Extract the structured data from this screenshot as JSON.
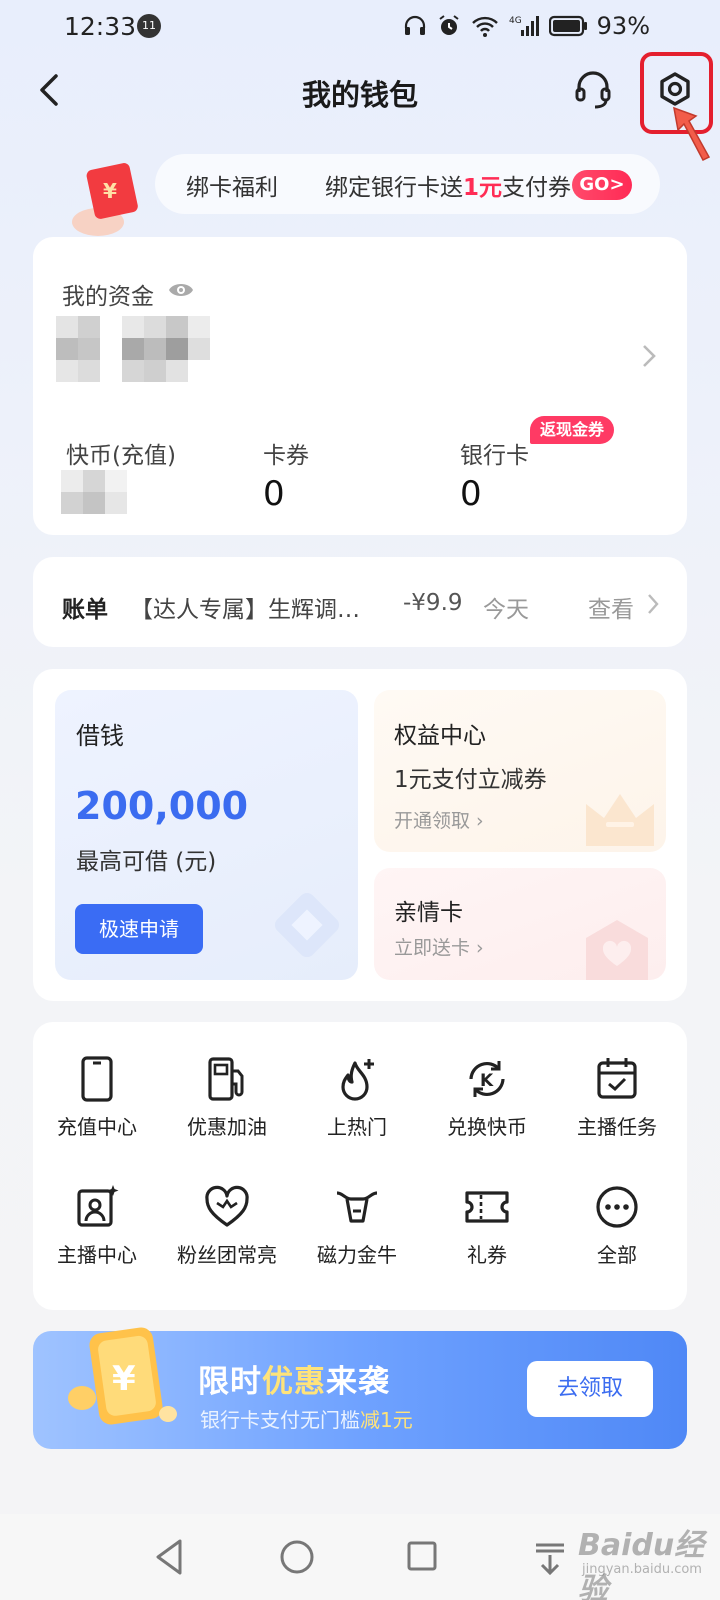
{
  "status_bar": {
    "time": "12:33",
    "clock_badge": "11",
    "battery": "93%"
  },
  "nav": {
    "title": "我的钱包"
  },
  "promo": {
    "label": "绑卡福利",
    "text_prefix": "绑定银行卡送",
    "text_highlight": "1元",
    "text_suffix": "支付券",
    "go": "GO>"
  },
  "assets": {
    "label": "我的资金",
    "kuaibi_label": "快币(充值)",
    "coupon_label": "卡券",
    "coupon_value": "0",
    "bank_label": "银行卡",
    "bank_value": "0",
    "cashback_badge": "返现金券"
  },
  "bill": {
    "label": "账单",
    "description": "【达人专属】生辉调…",
    "amount": "-¥9.9",
    "date": "今天",
    "view": "查看"
  },
  "loan": {
    "title": "借钱",
    "amount": "200,000",
    "caption": "最高可借 (元)",
    "button": "极速申请"
  },
  "benefit": {
    "title": "权益中心",
    "desc": "1元支付立减券",
    "link": "开通领取 ›"
  },
  "family": {
    "title": "亲情卡",
    "link": "立即送卡 ›"
  },
  "services": [
    {
      "label": "充值中心",
      "icon": "phone-icon"
    },
    {
      "label": "优惠加油",
      "icon": "fuel-pump-icon"
    },
    {
      "label": "上热门",
      "icon": "flame-plus-icon"
    },
    {
      "label": "兑换快币",
      "icon": "coin-exchange-icon"
    },
    {
      "label": "主播任务",
      "icon": "calendar-check-icon"
    },
    {
      "label": "主播中心",
      "icon": "streamer-profile-icon"
    },
    {
      "label": "粉丝团常亮",
      "icon": "heart-icon"
    },
    {
      "label": "磁力金牛",
      "icon": "bull-icon"
    },
    {
      "label": "礼券",
      "icon": "ticket-icon"
    },
    {
      "label": "全部",
      "icon": "more-dots-icon"
    }
  ],
  "banner": {
    "title_a": "限时",
    "title_hl": "优惠",
    "title_b": "来袭",
    "sub_a": "银行卡支付无门槛",
    "sub_hl": "减1元",
    "button": "去领取"
  },
  "watermark": {
    "main": "Baidu经验",
    "sub": "jingyan.baidu.com"
  },
  "colors": {
    "accent_blue": "#3b6cf0",
    "accent_red": "#ff2c55",
    "highlight_box": "#e41f2e"
  }
}
